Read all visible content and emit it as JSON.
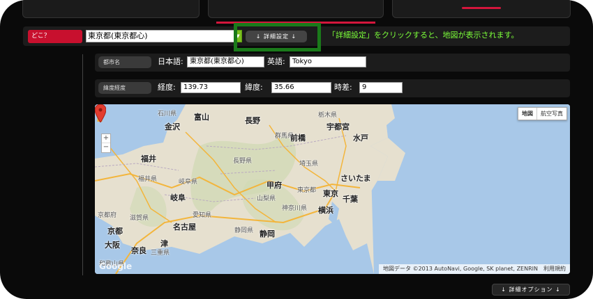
{
  "header": {
    "doko_label": "どこ？",
    "location_select_value": "東京都(東京都心)",
    "detail_button": "↓ 詳細設定 ↓",
    "hint": "「詳細設定」をクリックすると、地図が表示されます。"
  },
  "city_row": {
    "label": "都市名",
    "ja_label": "日本語:",
    "ja_value": "東京都(東京都心)",
    "en_label": "英語:",
    "en_value": "Tokyo"
  },
  "coord_row": {
    "label": "緯度経度",
    "lon_label": "経度:",
    "lon_value": "139.73",
    "lat_label": "緯度:",
    "lat_value": "35.66",
    "tz_label": "時差:",
    "tz_value": "9"
  },
  "map": {
    "type_map": "地図",
    "type_satellite": "航空写真",
    "attribution": "地図データ ©2013 AutoNavi, Google, SK planet, ZENRIN　利用規約",
    "logo": "Google",
    "zoom_in": "+",
    "zoom_out": "−",
    "places": {
      "ishikawa": "石川県",
      "toyama_city": "富山",
      "kanazawa": "金沢",
      "nagano": "長野",
      "gunma": "群馬県",
      "maebashi": "前橋",
      "tochigi": "栃木県",
      "utsunomiya": "宇都宮",
      "mito": "水戸",
      "fukui": "福井",
      "nagano_pref": "長野県",
      "saitama_pref": "埼玉県",
      "saitama": "さいたま",
      "fukui_pref": "福井県",
      "gifu_pref": "岐阜県",
      "kofu": "甲府",
      "tokyo_pref": "東京都",
      "tokyo": "東京",
      "chiba": "千葉",
      "gifu": "岐阜",
      "yamanashi": "山梨県",
      "kanagawa": "神奈川県",
      "yokohama": "横浜",
      "kyoto_pref": "京都府",
      "shiga": "滋賀県",
      "aichi": "愛知県",
      "shizuoka_pref": "静岡県",
      "nagoya": "名古屋",
      "kyoto": "京都",
      "osaka": "大阪",
      "nara": "奈良",
      "shizuoka": "静岡",
      "tsu": "津",
      "mie": "三重県",
      "wakayama": "和歌山県"
    }
  },
  "footer": {
    "options_button": "↓ 詳細オプション ↓"
  },
  "colors": {
    "accent": "#c8102e",
    "hint_green": "#7cff3a",
    "highlight_border": "#1a7a1a",
    "marker": "#e23b2e"
  }
}
